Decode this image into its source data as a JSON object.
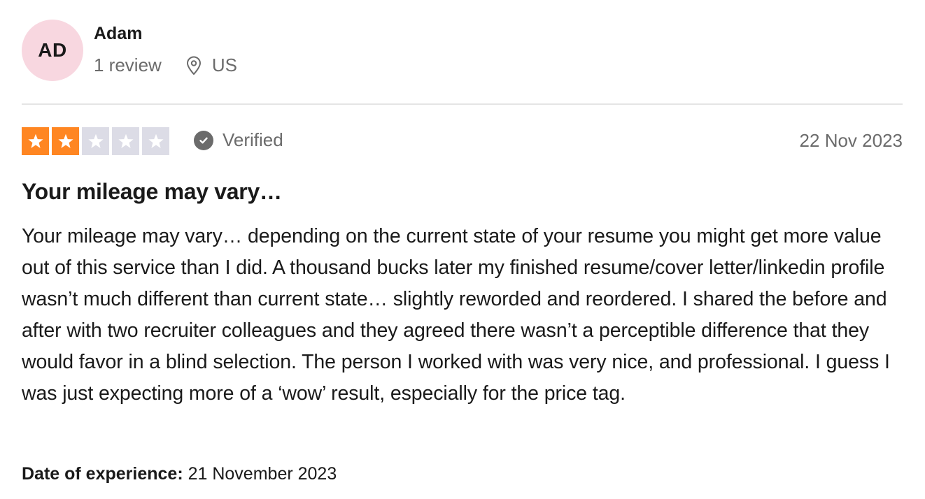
{
  "consumer": {
    "initials": "AD",
    "name": "Adam",
    "review_count": "1 review",
    "country": "US",
    "avatar_color": "#f8d7e0"
  },
  "review": {
    "rating": 2,
    "max_rating": 5,
    "star_filled_color": "#ff8622",
    "star_empty_color": "#dcdce6",
    "verified_label": "Verified",
    "date": "22 Nov 2023",
    "title": "Your mileage may vary…",
    "body": "Your mileage may vary… depending on the current state of your resume you might get more value out of this service than I did. A thousand bucks later my finished resume/cover letter/linkedin profile wasn’t much different than current state… slightly reworded and reordered. I shared the before and after with two recruiter colleagues and they agreed there wasn’t a perceptible difference that they would favor in a blind selection. The person I worked with was very nice, and professional. I guess I was just expecting more of a ‘wow’ result, especially for the price tag.",
    "experience_label": "Date of experience:",
    "experience_date": "21 November 2023"
  },
  "icons": {
    "location": "location-pin-icon",
    "verified": "checkmark-circle-icon",
    "star": "star-icon"
  }
}
